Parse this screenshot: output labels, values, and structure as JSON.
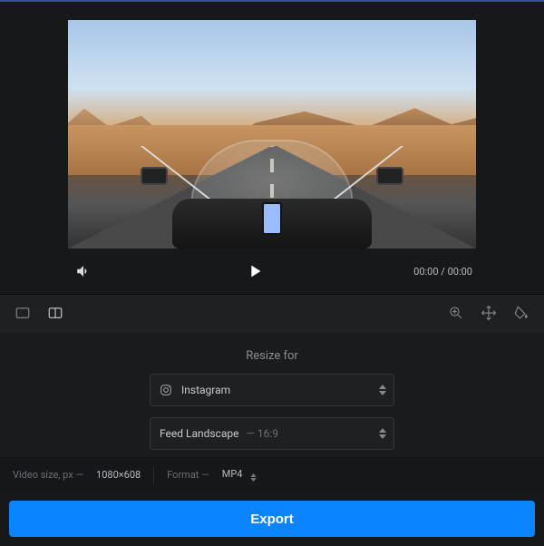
{
  "player": {
    "currentTime": "00:00",
    "duration": "00:00"
  },
  "resize": {
    "title": "Resize for",
    "platform": {
      "value": "Instagram"
    },
    "aspect": {
      "label": "Feed Landscape",
      "ratio": "16:9"
    }
  },
  "footer": {
    "sizeLabel": "Video size, px —",
    "sizeValue": "1080×608",
    "formatLabel": "Format —",
    "formatValue": "MP4"
  },
  "actions": {
    "export": "Export"
  }
}
